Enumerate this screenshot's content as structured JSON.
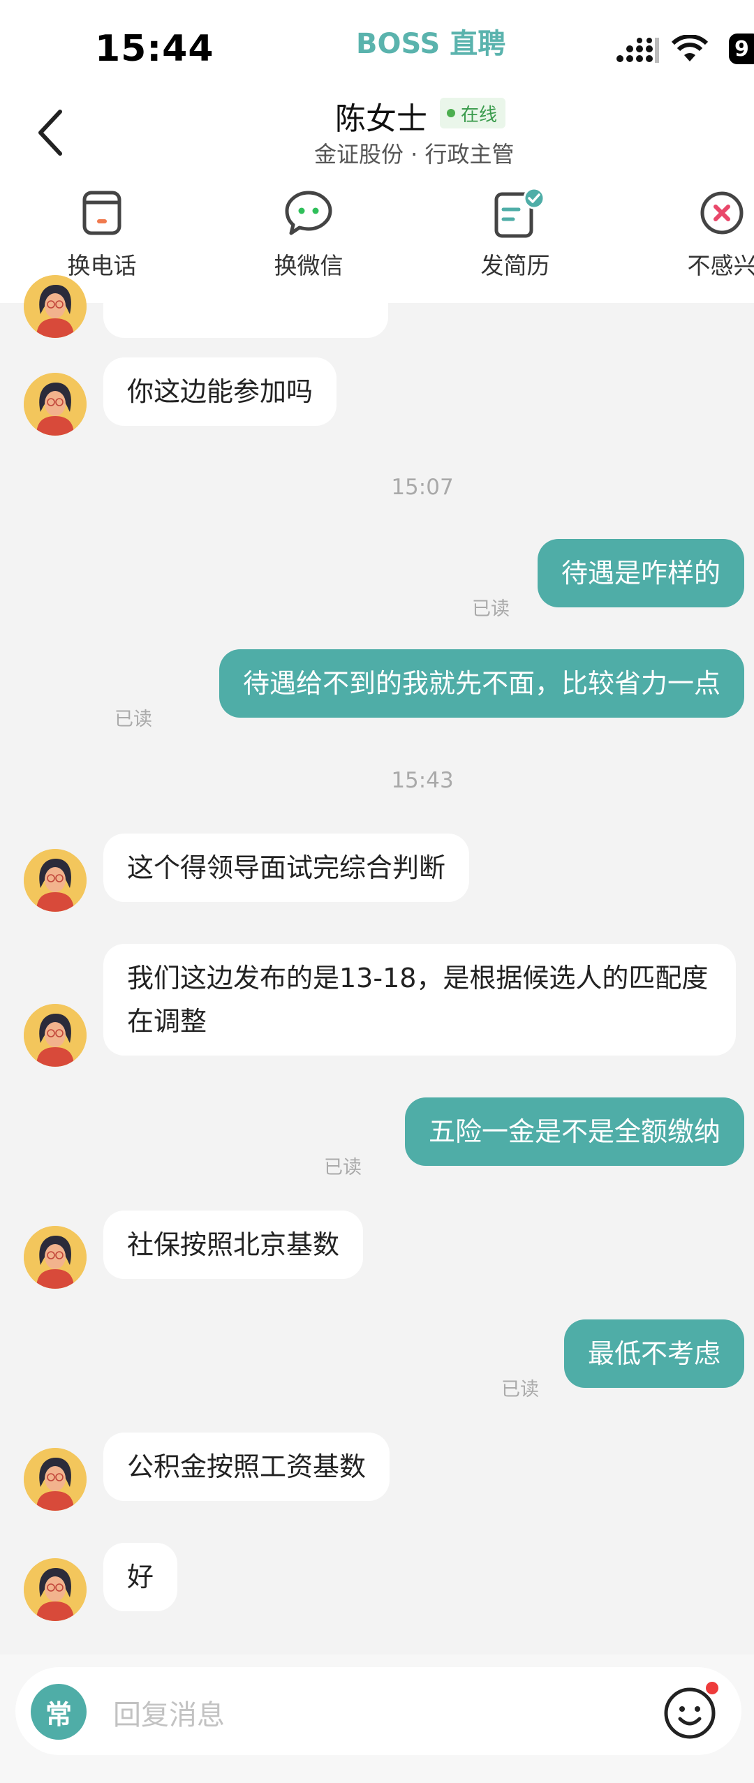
{
  "status_bar": {
    "time": "15:44",
    "battery": "9"
  },
  "brand": "BOSS 直聘",
  "header": {
    "contact_name": "陈女士",
    "online": "在线",
    "subtitle": "金证股份 · 行政主管"
  },
  "actions": [
    {
      "label": "换电话",
      "icon": "phone-card-icon"
    },
    {
      "label": "换微信",
      "icon": "wechat-icon"
    },
    {
      "label": "发简历",
      "icon": "resume-check-icon"
    },
    {
      "label": "不感兴",
      "icon": "not-interested-icon"
    }
  ],
  "messages": {
    "m1": "你这边能参加吗",
    "ts1": "15:07",
    "m2": "待遇是咋样的",
    "m3": "待遇给不到的我就先不面，比较省力一点",
    "ts2": "15:43",
    "m4": "这个得领导面试完综合判断",
    "m5": "我们这边发布的是13-18，是根据候选人的匹配度在调整",
    "m6": "五险一金是不是全额缴纳",
    "m7": "社保按照北京基数",
    "m8": "最低不考虑",
    "m9": "公积金按照工资基数",
    "m10": "好",
    "read_label": "已读"
  },
  "input": {
    "common_label": "常",
    "placeholder": "回复消息"
  },
  "colors": {
    "accent": "#4fada7",
    "brand": "#5ab3ad",
    "online": "#4cae4f"
  }
}
